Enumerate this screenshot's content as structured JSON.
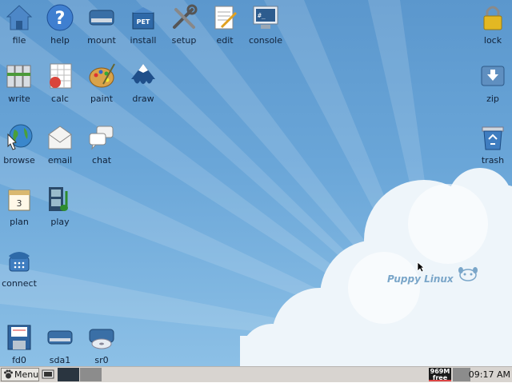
{
  "desktop": {
    "brand_text": "Puppy Linux",
    "colors": {
      "sky_top": "#5b97cd",
      "sky_bottom": "#8cc0e6",
      "cloud": "#eef5fa"
    },
    "left_icons": [
      {
        "label": "file",
        "icon": "home-folder-icon"
      },
      {
        "label": "help",
        "icon": "help-icon"
      },
      {
        "label": "mount",
        "icon": "drive-icon"
      },
      {
        "label": "install",
        "icon": "pet-package-icon"
      },
      {
        "label": "setup",
        "icon": "tools-icon"
      },
      {
        "label": "edit",
        "icon": "notepad-icon"
      },
      {
        "label": "console",
        "icon": "terminal-icon"
      },
      {
        "label": "write",
        "icon": "binders-icon"
      },
      {
        "label": "calc",
        "icon": "spreadsheet-icon"
      },
      {
        "label": "paint",
        "icon": "palette-icon"
      },
      {
        "label": "draw",
        "icon": "inkscape-icon"
      },
      {
        "label": "browse",
        "icon": "globe-icon"
      },
      {
        "label": "email",
        "icon": "envelope-icon"
      },
      {
        "label": "chat",
        "icon": "chat-icon"
      },
      {
        "label": "plan",
        "icon": "calendar-icon"
      },
      {
        "label": "play",
        "icon": "media-icon"
      },
      {
        "label": "connect",
        "icon": "phone-icon"
      }
    ],
    "right_icons": [
      {
        "label": "lock",
        "icon": "padlock-icon"
      },
      {
        "label": "zip",
        "icon": "archive-icon"
      },
      {
        "label": "trash",
        "icon": "trash-icon"
      }
    ],
    "drive_icons": [
      {
        "label": "fd0",
        "icon": "floppy-icon"
      },
      {
        "label": "sda1",
        "icon": "harddisk-icon"
      },
      {
        "label": "sr0",
        "icon": "cdrom-icon"
      }
    ]
  },
  "taskbar": {
    "menu_label": "Menu",
    "memory_line1": "969M",
    "memory_line2": "free",
    "clock": "09:17 AM"
  }
}
